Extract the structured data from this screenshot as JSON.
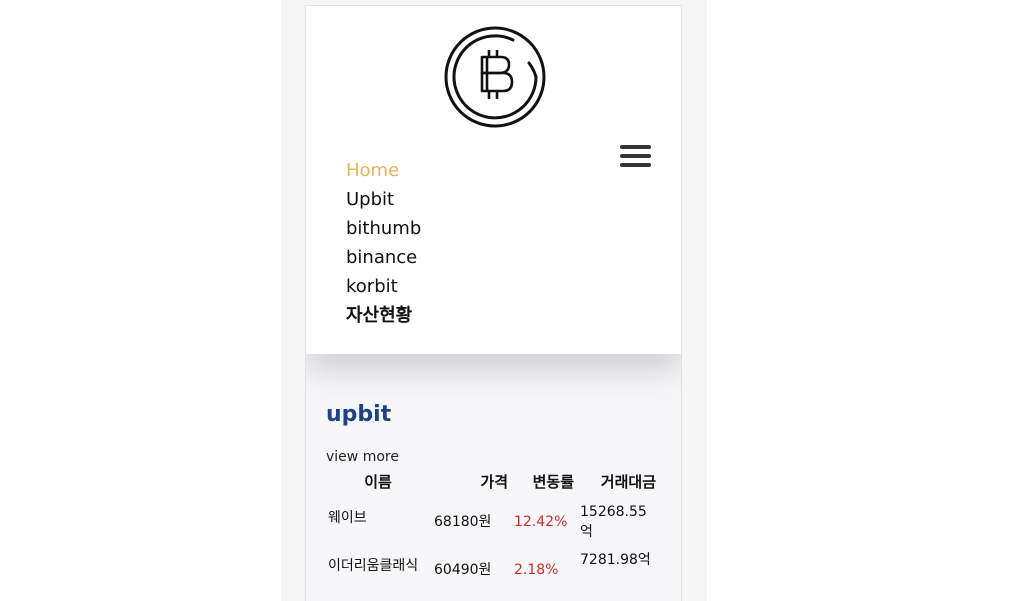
{
  "header": {
    "logo_icon": "bitcoin-icon"
  },
  "nav": {
    "items": [
      {
        "label": "Home"
      },
      {
        "label": "Upbit"
      },
      {
        "label": "bithumb"
      },
      {
        "label": "binance"
      },
      {
        "label": "korbit"
      },
      {
        "label": "자산현황"
      }
    ],
    "active_color": "#e8b35a",
    "menu_icon": "hamburger-menu-icon"
  },
  "section": {
    "title": "upbit",
    "title_color": "#1d4585",
    "view_more": "view more"
  },
  "table": {
    "columns": [
      "이름",
      "가격",
      "변동률",
      "거래대금"
    ],
    "rows": [
      {
        "name": "웨이브",
        "price": "68180원",
        "rate": "12.42%",
        "volume": "15268.55억"
      },
      {
        "name": "이더리움클래식",
        "price": "60490원",
        "rate": "2.18%",
        "volume": "7281.98억"
      }
    ],
    "rate_color": "#d22a2a"
  }
}
